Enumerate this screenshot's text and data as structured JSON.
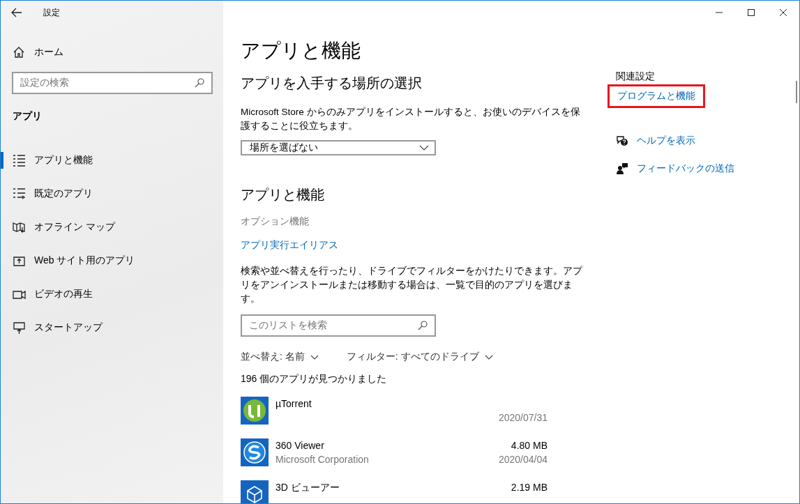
{
  "window": {
    "title": "設定"
  },
  "sidebar": {
    "home": "ホーム",
    "search": {
      "placeholder": "設定の検索"
    },
    "section": "アプリ",
    "items": [
      {
        "label": "アプリと機能",
        "kind": "list",
        "selected": true
      },
      {
        "label": "既定のアプリ",
        "kind": "default",
        "selected": false
      },
      {
        "label": "オフライン マップ",
        "kind": "map",
        "selected": false
      },
      {
        "label": "Web サイト用のアプリ",
        "kind": "web",
        "selected": false
      },
      {
        "label": "ビデオの再生",
        "kind": "video",
        "selected": false
      },
      {
        "label": "スタートアップ",
        "kind": "startup",
        "selected": false
      }
    ]
  },
  "main": {
    "title": "アプリと機能",
    "install_source": {
      "heading": "アプリを入手する場所の選択",
      "description": "Microsoft Store からのみアプリをインストールすると、お使いのデバイスを保護することに役立ちます。",
      "dropdown": "場所を選ばない"
    },
    "apps_section": {
      "heading": "アプリと機能",
      "optional_features": "オプション機能",
      "alias_link": "アプリ実行エイリアス",
      "description": "検索や並べ替えを行ったり、ドライブでフィルターをかけたりできます。アプリをアンインストールまたは移動する場合は、一覧で目的のアプリを選びます。",
      "search": {
        "placeholder": "このリストを検索"
      },
      "sort": "並べ替え: 名前",
      "filter": "フィルター: すべてのドライブ",
      "count": "196 個のアプリが見つかりました",
      "apps": [
        {
          "name": "µTorrent",
          "kind": "utorrent",
          "date": "2020/07/31"
        },
        {
          "name": "360 Viewer",
          "kind": "viewer360",
          "size": "4.80 MB",
          "publisher": "Microsoft Corporation",
          "date": "2020/04/04"
        },
        {
          "name": "3D ビューアー",
          "kind": "viewer3d",
          "size": "2.19 MB"
        }
      ]
    }
  },
  "related": {
    "heading": "関連設定",
    "link": {
      "label": "プログラムと機能",
      "highlighted": true
    },
    "support": [
      {
        "label": "ヘルプを表示",
        "kind": "help"
      },
      {
        "label": "フィードバックの送信",
        "kind": "feedback"
      }
    ]
  }
}
